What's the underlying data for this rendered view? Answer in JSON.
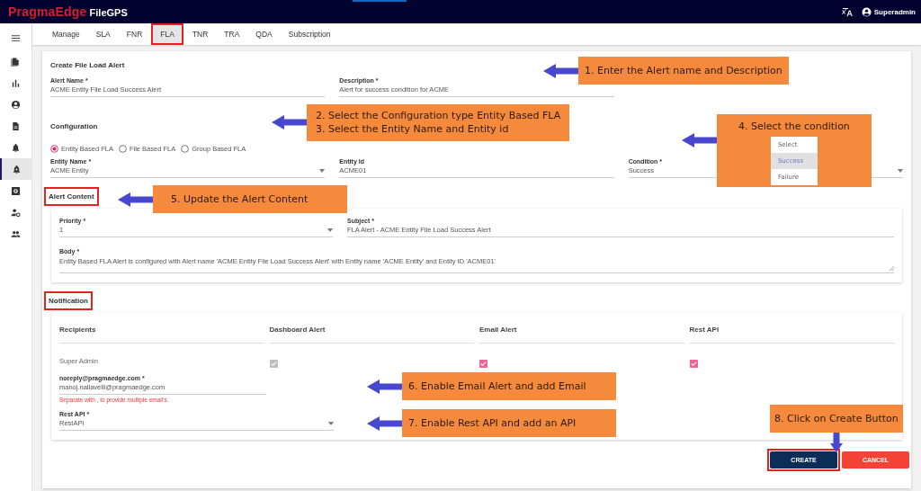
{
  "header": {
    "brand": "PragmaEdge",
    "product": "FileGPS",
    "user": "Superadmin"
  },
  "sidebar": {
    "items": [
      {
        "selected": false
      },
      {
        "selected": false
      },
      {
        "selected": false
      },
      {
        "selected": false
      },
      {
        "selected": false
      },
      {
        "selected": true
      },
      {
        "selected": false
      },
      {
        "selected": false
      },
      {
        "selected": false
      }
    ]
  },
  "tabs": [
    {
      "label": "Manage",
      "selected": false,
      "highlighted": false
    },
    {
      "label": "SLA",
      "selected": false,
      "highlighted": false
    },
    {
      "label": "FNR",
      "selected": false,
      "highlighted": false
    },
    {
      "label": "FLA",
      "selected": true,
      "highlighted": true
    },
    {
      "label": "TNR",
      "selected": false,
      "highlighted": false
    },
    {
      "label": "TRA",
      "selected": false,
      "highlighted": false
    },
    {
      "label": "QDA",
      "selected": false,
      "highlighted": false
    },
    {
      "label": "Subscription",
      "selected": false,
      "highlighted": false
    }
  ],
  "form": {
    "title": "Create File Load Alert",
    "fields": [
      {
        "label": "Alert Name *",
        "value": "ACME Entity File Load Success Alert",
        "kind": "text"
      },
      {
        "label": "Description *",
        "value": "Alert for success condition for ACME",
        "kind": "text"
      }
    ],
    "configuration": {
      "heading": "Configuration",
      "radios": [
        {
          "label": "Entity Based FLA",
          "selected": true
        },
        {
          "label": "File Based FLA",
          "selected": false
        },
        {
          "label": "Group Based FLA",
          "selected": false
        }
      ],
      "fields": [
        {
          "label": "Entity Name *",
          "value": "ACME Entity",
          "kind": "select"
        },
        {
          "label": "Entity Id",
          "value": "ACME01",
          "kind": "text"
        },
        {
          "label": "Condition *",
          "value": "Success",
          "kind": "select"
        }
      ]
    },
    "alert_content": {
      "heading": "Alert Content",
      "highlighted": true,
      "fields": [
        {
          "label": "Priority *",
          "value": "1",
          "kind": "select"
        },
        {
          "label": "Subject *",
          "value": "FLA Alert - ACME Entity File Load Success Alert",
          "kind": "text"
        }
      ],
      "body": {
        "label": "Body *",
        "value": "Entity Based FLA Alert is configured with Alert name 'ACME Entity File Load Success Alert' with Entity name 'ACME Entity' and Entity ID 'ACME01'"
      }
    },
    "notification": {
      "heading": "Notification",
      "highlighted": true,
      "columns": [
        "Recipients",
        "Dashboard Alert",
        "Email Alert",
        "Rest API"
      ],
      "rows": [
        {
          "recipient": "Super Admin",
          "checks": [
            {
              "checked": true,
              "disabled": true
            },
            {
              "checked": true,
              "disabled": false
            },
            {
              "checked": true,
              "disabled": false
            }
          ]
        }
      ],
      "email": {
        "label": "noreply@pragmaedge.com *",
        "value": "manoj.nallavelli@pragmaedge.com",
        "hint": "Separate with , to provide multiple email's."
      },
      "rest_api": {
        "label": "Rest API *",
        "value": "RestAPI"
      }
    },
    "buttons": [
      {
        "label": "CREATE",
        "kind": "primary",
        "highlighted": true
      },
      {
        "label": "CANCEL",
        "kind": "danger",
        "highlighted": false
      }
    ]
  },
  "annotations": [
    {
      "lines": [
        "1. Enter the Alert name and Description"
      ],
      "kind": "left"
    },
    {
      "lines": [
        "2. Select the Configuration type Entity Based FLA",
        "3. Select the Entity Name and Entity id"
      ],
      "kind": "left"
    },
    {
      "lines": [
        "4. Select the condition"
      ],
      "kind": "left",
      "options": [
        {
          "label": "Select",
          "selected": false
        },
        {
          "label": "Success",
          "selected": true
        },
        {
          "label": "Failure",
          "selected": false
        }
      ]
    },
    {
      "lines": [
        "5. Update the Alert Content"
      ],
      "kind": "left"
    },
    {
      "lines": [
        "6. Enable Email Alert and add Email"
      ],
      "kind": "left"
    },
    {
      "lines": [
        "7. Enable Rest API and add an API"
      ],
      "kind": "left"
    },
    {
      "lines": [
        "8. Click on Create Button"
      ],
      "kind": "down"
    }
  ]
}
